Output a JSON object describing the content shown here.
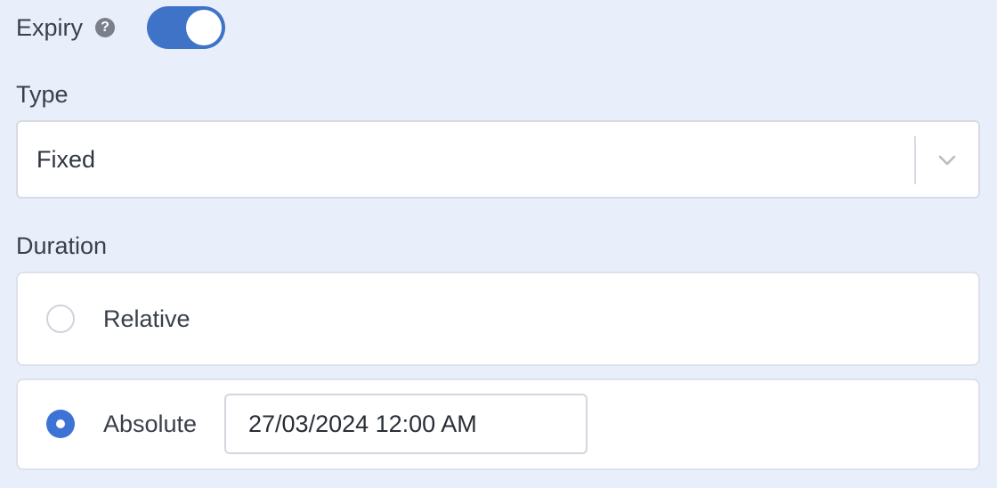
{
  "expiry": {
    "label": "Expiry",
    "help_icon": "question-circle-icon",
    "help_glyph": "?",
    "toggle_on": true,
    "accent_color": "#3e73c7"
  },
  "type": {
    "label": "Type",
    "selected": "Fixed",
    "chevron_icon": "chevron-down-icon"
  },
  "duration": {
    "label": "Duration",
    "options": [
      {
        "label": "Relative",
        "selected": false
      },
      {
        "label": "Absolute",
        "selected": true
      }
    ],
    "absolute_value": "27/03/2024 12:00 AM",
    "radio_color": "#3e73d6"
  }
}
